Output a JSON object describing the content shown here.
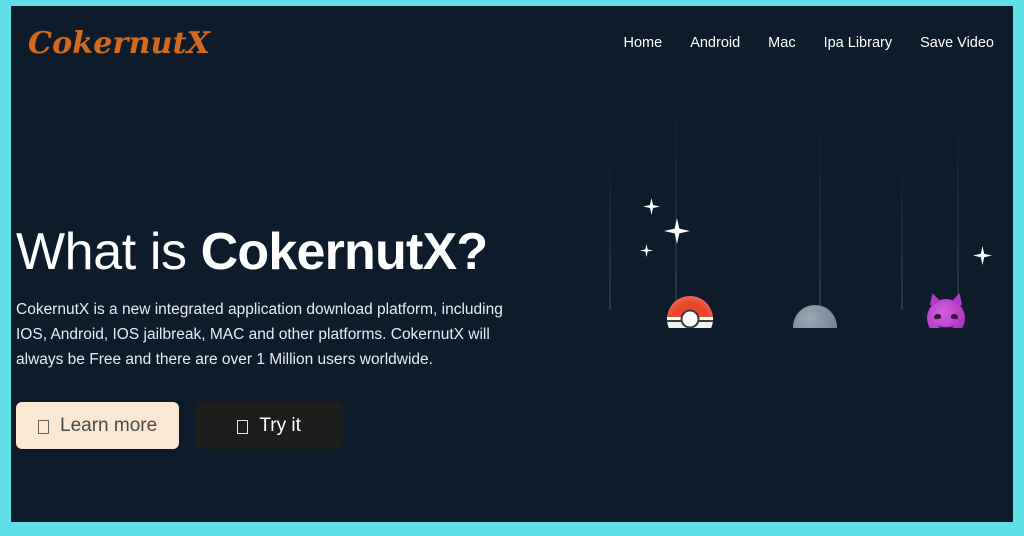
{
  "theme": {
    "frame_color": "#5fdfe8",
    "page_bg": "#0d1b2a",
    "logo_color": "#d2691e",
    "accent_button_bg": "#fbe8d3",
    "dark_button_bg": "#1d1d1d",
    "text_color": "#ffffff"
  },
  "header": {
    "logo": "CokernutX",
    "nav": [
      {
        "label": "Home"
      },
      {
        "label": "Android"
      },
      {
        "label": "Mac"
      },
      {
        "label": "Ipa Library"
      },
      {
        "label": "Save Video"
      }
    ]
  },
  "hero": {
    "title_light": "What is ",
    "title_strong": "CokernutX?",
    "description": "CokernutX is a new integrated application download platform, including IOS, Android, IOS jailbreak, MAC and other platforms. CokernutX will always be Free and there are over 1 Million users worldwide.",
    "buttons": [
      {
        "label": "Learn more",
        "icon": "missing-glyph-box",
        "style": "light"
      },
      {
        "label": "Try it",
        "icon": "missing-glyph-box",
        "style": "dark"
      }
    ]
  },
  "artwork": {
    "items": [
      {
        "icon": "pokeball-emoji"
      },
      {
        "icon": "grey-dome-emoji"
      },
      {
        "icon": "purple-devil-emoji"
      }
    ],
    "sparkles": 4,
    "streaks": 5
  }
}
